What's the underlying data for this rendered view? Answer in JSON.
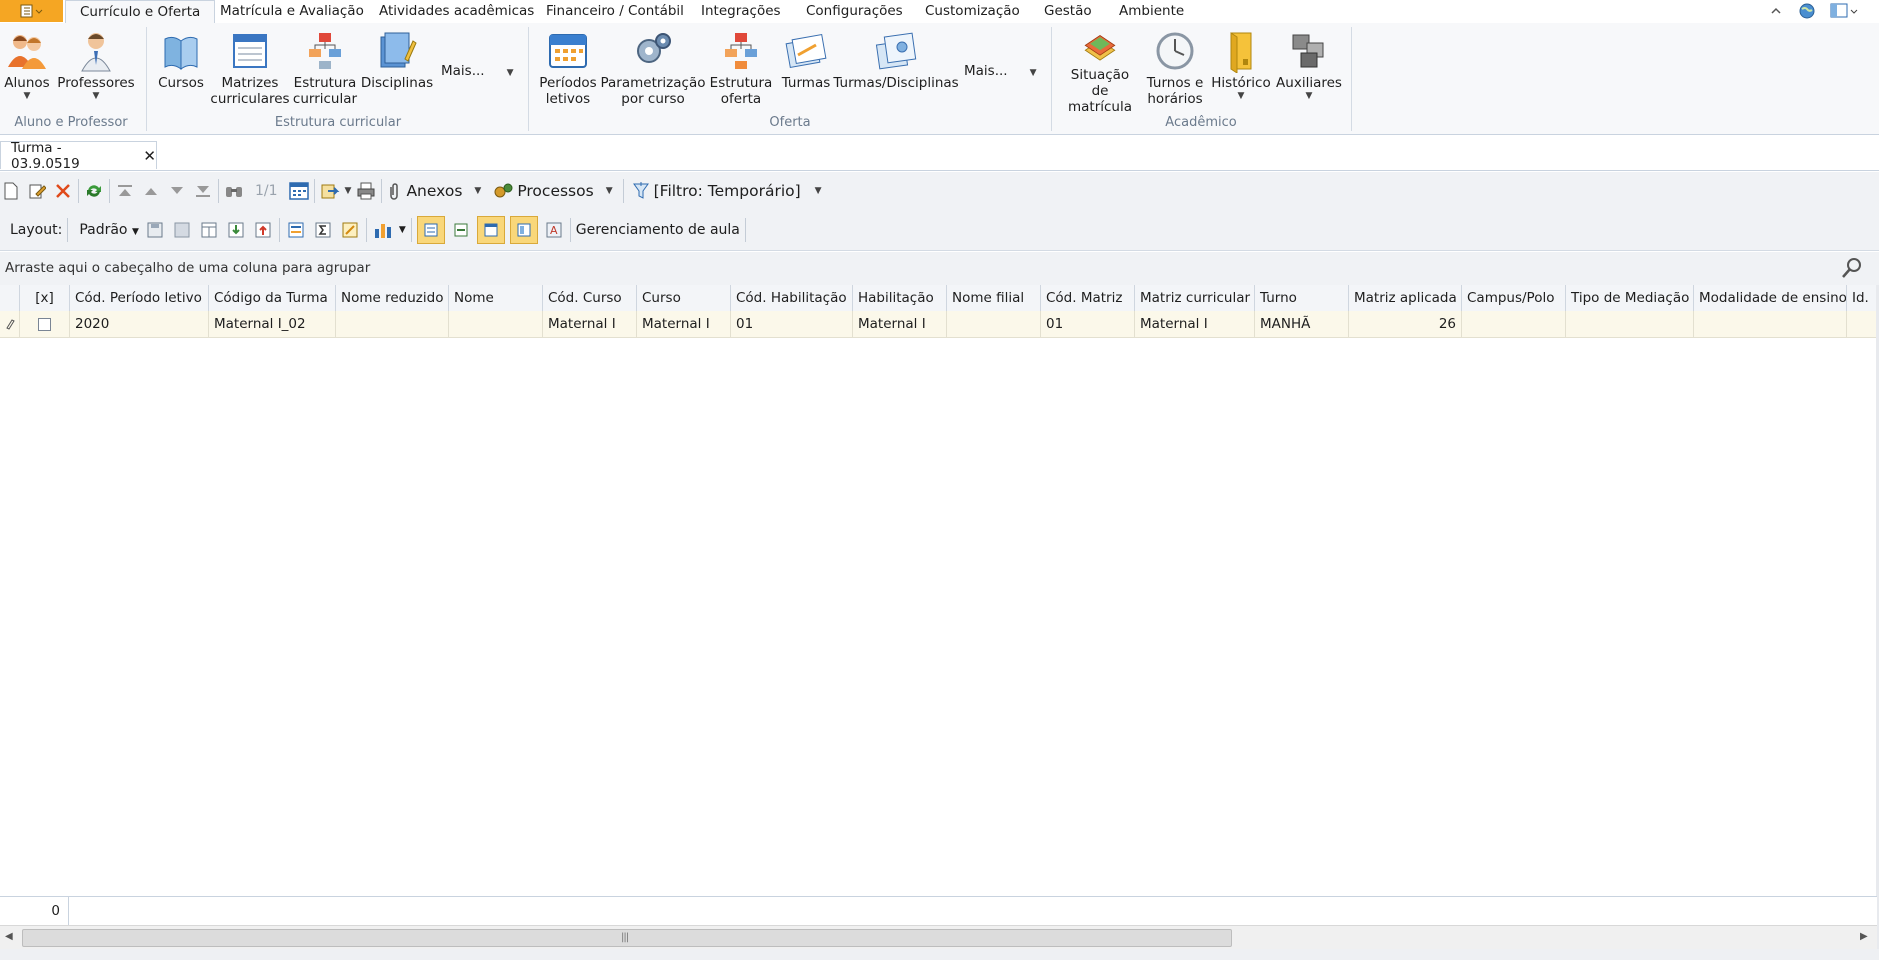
{
  "ribbon_tabs": [
    "Currículo e Oferta",
    "Matrícula e Avaliação",
    "Atividades acadêmicas",
    "Financeiro / Contábil",
    "Integrações",
    "Configurações",
    "Customização",
    "Gestão",
    "Ambiente"
  ],
  "ribbon_groups": {
    "aluno_professor": {
      "label": "Aluno e Professor",
      "buttons": [
        {
          "label": "Alunos",
          "icon": "students-icon"
        },
        {
          "label": "Professores",
          "icon": "teacher-icon"
        }
      ]
    },
    "estrutura": {
      "label": "Estrutura curricular",
      "buttons": [
        {
          "label": "Cursos",
          "icon": "book-icon"
        },
        {
          "label": "Matrizes\ncurriculares",
          "icon": "curriculum-matrix-icon"
        },
        {
          "label": "Estrutura\ncurricular",
          "icon": "curriculum-structure-icon"
        },
        {
          "label": "Disciplinas",
          "icon": "discipline-icon"
        }
      ],
      "more": "Mais..."
    },
    "oferta": {
      "label": "Oferta",
      "buttons": [
        {
          "label": "Períodos\nletivos",
          "icon": "calendar-icon"
        },
        {
          "label": "Parametrização\npor curso",
          "icon": "gears-icon"
        },
        {
          "label": "Estrutura\noferta",
          "icon": "offer-structure-icon"
        },
        {
          "label": "Turmas",
          "icon": "classes-icon"
        },
        {
          "label": "Turmas/Disciplinas",
          "icon": "class-disciplines-icon"
        }
      ],
      "more": "Mais..."
    },
    "academico": {
      "label": "Acadêmico",
      "buttons": [
        {
          "label": "Situação de\nmatrícula",
          "icon": "enrollment-status-icon"
        },
        {
          "label": "Turnos e\nhorários",
          "icon": "clock-icon"
        },
        {
          "label": "Histórico",
          "icon": "folder-icon"
        },
        {
          "label": "Auxiliares",
          "icon": "auxiliary-icon"
        }
      ]
    }
  },
  "document_tab": {
    "title": "Turma - 03.9.0519"
  },
  "toolbar1": {
    "page": "1/1",
    "anexos": "Anexos",
    "processos": "Processos",
    "filtro": "[Filtro: Temporário]"
  },
  "toolbar2": {
    "layout_label": "Layout:",
    "layout_value": "Padrão",
    "gerenciamento": "Gerenciamento de aula"
  },
  "group_hint": "Arraste aqui o cabeçalho de uma coluna para agrupar",
  "columns": [
    "[x]",
    "Cód. Período letivo",
    "Código da Turma",
    "Nome reduzido",
    "Nome",
    "Cód. Curso",
    "Curso",
    "Cód. Habilitação",
    "Habilitação",
    "Nome filial",
    "Cód. Matriz",
    "Matriz curricular",
    "Turno",
    "Matriz aplicada",
    "Campus/Polo",
    "Tipo de Mediação",
    "Modalidade de ensino",
    "Id."
  ],
  "rows": [
    [
      "",
      "2020",
      "Maternal I_02",
      "",
      "",
      "Maternal I",
      "Maternal I",
      "01",
      "Maternal I",
      "",
      "01",
      "Maternal I",
      "MANHÃ",
      "26",
      "",
      "",
      "",
      ""
    ]
  ],
  "footer": {
    "count": "0"
  },
  "colors": {
    "app_button": "#f5a623",
    "row_highlight": "#fbf8ea",
    "toggle_active": "#f9d77a"
  }
}
